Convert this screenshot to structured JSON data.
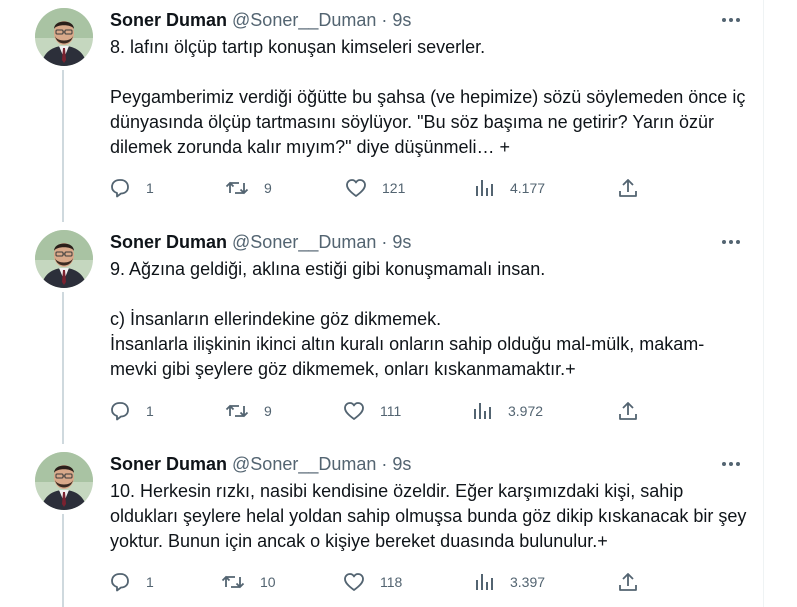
{
  "tweets": [
    {
      "name": "Soner Duman",
      "handle": "@Soner__Duman",
      "separator": "·",
      "time": "9s",
      "text": "8. lafını ölçüp tartıp konuşan kimseleri severler.\n\nPeygamberimiz verdiği öğütte bu şahsa (ve hepimize) sözü söylemeden önce iç dünyasında ölçüp tartmasını söylüyor. \"Bu söz başıma ne getirir? Yarın özür dilemek zorunda kalır mıyım?\" diye düşünmeli… +",
      "replies": "1",
      "retweets": "9",
      "likes": "121",
      "views": "4.177"
    },
    {
      "name": "Soner Duman",
      "handle": "@Soner__Duman",
      "separator": "·",
      "time": "9s",
      "text": "9. Ağzına geldiği, aklına estiği gibi konuşmamalı insan.\n\nc) İnsanların ellerindekine göz dikmemek.\nİnsanlarla ilişkinin ikinci altın kuralı onların sahip olduğu mal-mülk, makam-mevki gibi şeylere göz dikmemek, onları kıskanmamaktır.+",
      "replies": "1",
      "retweets": "9",
      "likes": "111",
      "views": "3.972"
    },
    {
      "name": "Soner Duman",
      "handle": "@Soner__Duman",
      "separator": "·",
      "time": "9s",
      "text": "10. Herkesin rızkı, nasibi kendisine özeldir. Eğer karşımızdaki kişi, sahip oldukları şeylere helal yoldan sahip olmuşsa bunda göz dikip kıskanacak bir şey yoktur. Bunun için ancak o kişiye bereket duasında bulunulur.+",
      "replies": "1",
      "retweets": "10",
      "likes": "118",
      "views": "3.397"
    }
  ],
  "icons": {
    "reply": "reply-icon",
    "retweet": "retweet-icon",
    "like": "heart-icon",
    "views": "views-icon",
    "share": "share-icon",
    "more": "more-icon"
  },
  "colors": {
    "text": "#0f1419",
    "secondary": "#536471",
    "thread_line": "#cfd9de",
    "divider": "#eff3f4"
  }
}
